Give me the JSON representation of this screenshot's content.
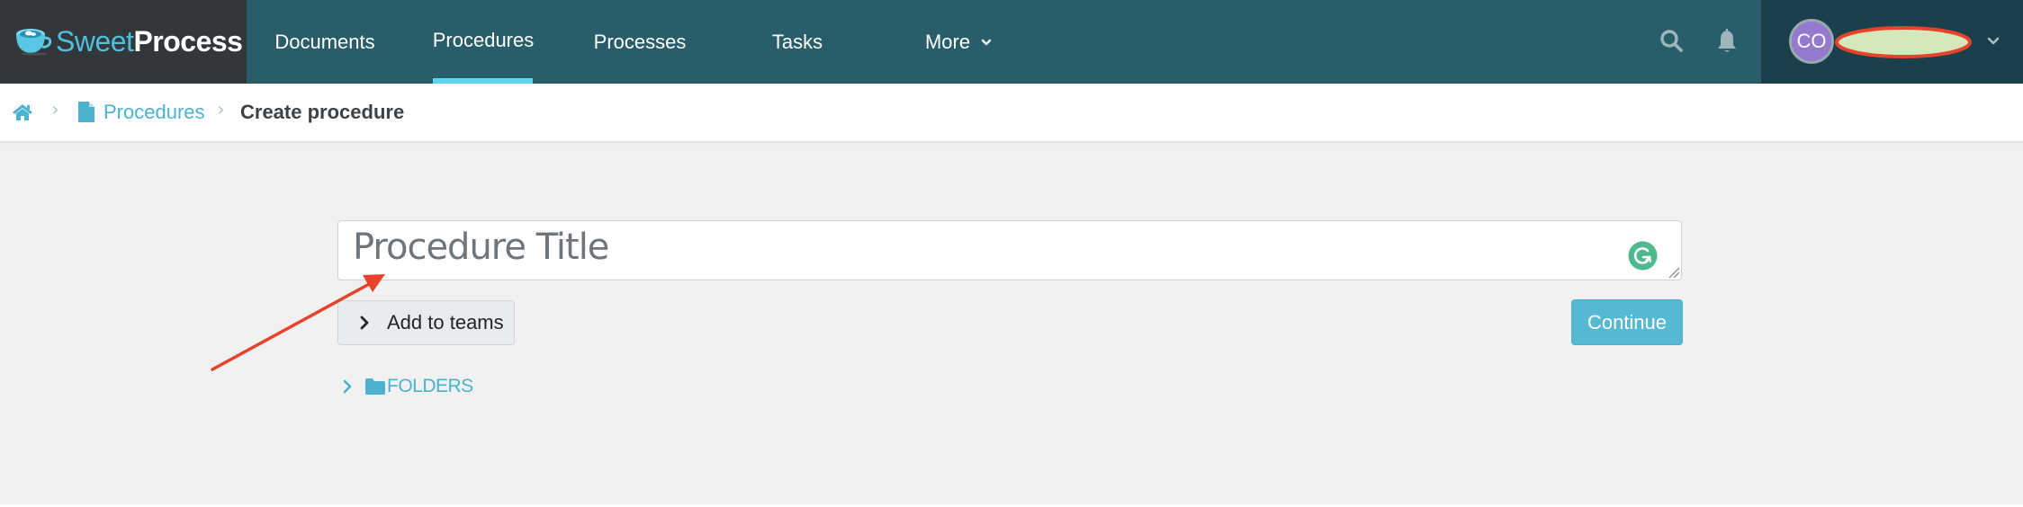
{
  "navbar": {
    "logo": {
      "part1": "Sweet",
      "part2": "Process"
    },
    "items": [
      {
        "label": "Documents",
        "active": false
      },
      {
        "label": "Procedures",
        "active": true
      },
      {
        "label": "Processes",
        "active": false
      },
      {
        "label": "Tasks",
        "active": false
      },
      {
        "label": "More",
        "active": false,
        "has_dropdown": true
      }
    ],
    "icons": [
      "search-icon",
      "bell-icon"
    ],
    "user": {
      "initials": "CO",
      "name_redacted": true
    }
  },
  "breadcrumb": {
    "home_icon": "home-icon",
    "items": [
      {
        "label": "Procedures",
        "icon": "document-icon",
        "link": true
      },
      {
        "label": "Create procedure",
        "link": false
      }
    ],
    "separator": "›"
  },
  "form": {
    "title_input": {
      "value": "",
      "placeholder": "Procedure Title"
    },
    "add_to_teams_label": "Add to teams",
    "continue_label": "Continue",
    "folders_label": "FOLDERS"
  },
  "colors": {
    "navbar_bg": "#285d69",
    "logo_bg": "#32373c",
    "user_area_bg": "#1b404b",
    "accent": "#4bb2cf",
    "active_tab_underline": "#5fd5f2",
    "continue_button": "#56b9d2",
    "avatar": "#9579cf",
    "annotation_red": "#e6432a",
    "redaction_fill": "#d4e8bb"
  }
}
